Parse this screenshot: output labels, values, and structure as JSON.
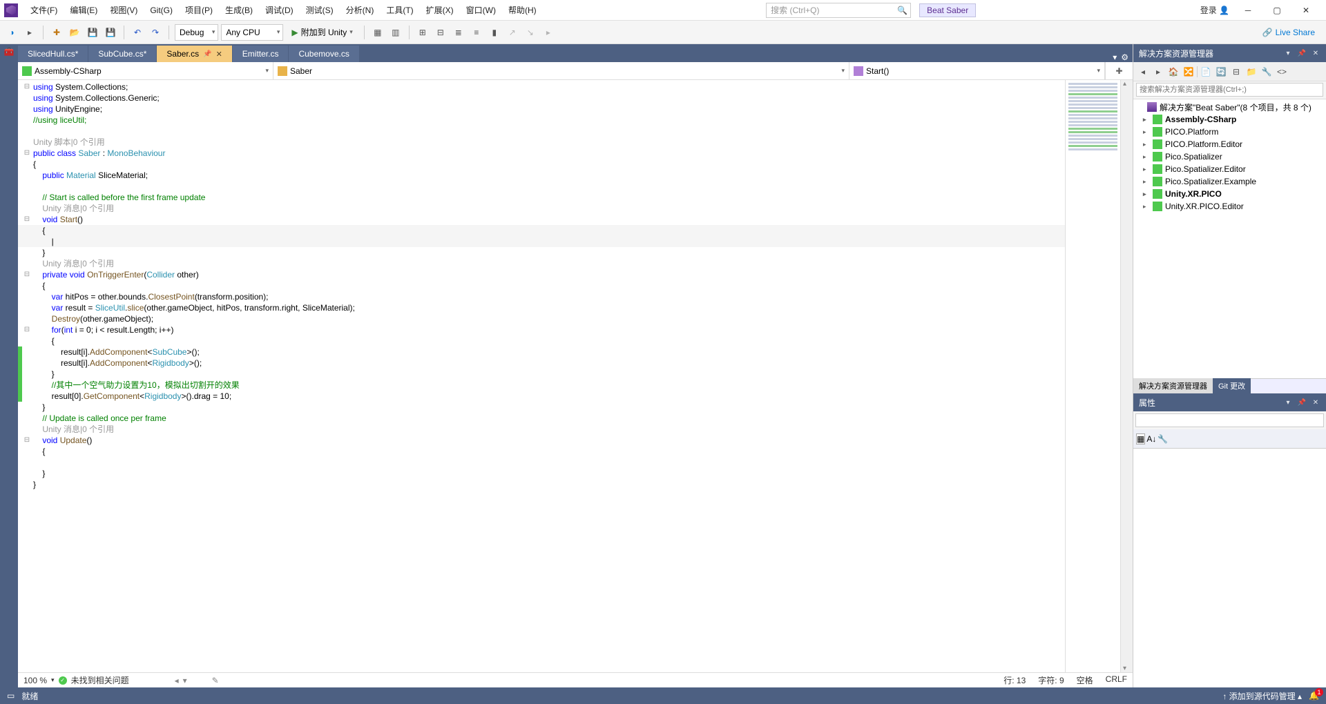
{
  "menu": {
    "items": [
      "文件(F)",
      "编辑(E)",
      "视图(V)",
      "Git(G)",
      "项目(P)",
      "生成(B)",
      "调试(D)",
      "测试(S)",
      "分析(N)",
      "工具(T)",
      "扩展(X)",
      "窗口(W)",
      "帮助(H)"
    ],
    "search_placeholder": "搜索 (Ctrl+Q)",
    "project": "Beat Saber",
    "login": "登录",
    "win": {
      "min": "─",
      "max": "▢",
      "close": "✕"
    }
  },
  "toolbar": {
    "config": "Debug",
    "platform": "Any CPU",
    "run_label": "附加到 Unity",
    "live_share": "Live Share"
  },
  "tabs": [
    {
      "label": "SlicedHull.cs*",
      "active": false
    },
    {
      "label": "SubCube.cs*",
      "active": false
    },
    {
      "label": "Saber.cs",
      "active": true,
      "pinned": true,
      "closable": true
    },
    {
      "label": "Emitter.cs",
      "active": false
    },
    {
      "label": "Cubemove.cs",
      "active": false
    }
  ],
  "nav": {
    "project": "Assembly-CSharp",
    "class": "Saber",
    "member": "Start()"
  },
  "code": {
    "lines": [
      {
        "fold": "⊟",
        "html": "<span class='kw'>using</span> System.Collections;"
      },
      {
        "fold": "",
        "html": "<span class='kw'>using</span> System.Collections.Generic;"
      },
      {
        "fold": "",
        "html": "<span class='kw'>using</span> UnityEngine;"
      },
      {
        "fold": "",
        "html": "<span class='cmt'>//using liceUtil;</span>"
      },
      {
        "fold": "",
        "html": ""
      },
      {
        "fold": "",
        "html": "<span class='gray'>Unity 脚本|0 个引用</span>"
      },
      {
        "fold": "⊟",
        "html": "<span class='kw'>public class</span> <span class='cls'>Saber</span> : <span class='cls'>MonoBehaviour</span>"
      },
      {
        "fold": "",
        "html": "{"
      },
      {
        "fold": "",
        "html": "    <span class='kw'>public</span> <span class='cls'>Material</span> SliceMaterial;"
      },
      {
        "fold": "",
        "html": ""
      },
      {
        "fold": "",
        "html": "    <span class='cmt'>// Start is called before the first frame update</span>"
      },
      {
        "fold": "",
        "html": "    <span class='gray'>Unity 消息|0 个引用</span>"
      },
      {
        "fold": "⊟",
        "html": "    <span class='kw'>void</span> <span class='mtd'>Start</span>()"
      },
      {
        "fold": "",
        "html": "    {",
        "caret": true
      },
      {
        "fold": "",
        "html": "        |",
        "caret": true
      },
      {
        "fold": "",
        "html": "    }"
      },
      {
        "fold": "",
        "html": "    <span class='gray'>Unity 消息|0 个引用</span>"
      },
      {
        "fold": "⊟",
        "html": "    <span class='kw'>private void</span> <span class='mtd'>OnTriggerEnter</span>(<span class='cls'>Collider</span> other)"
      },
      {
        "fold": "",
        "html": "    {"
      },
      {
        "fold": "",
        "html": "        <span class='kw'>var</span> hitPos = other.bounds.<span class='mtd'>ClosestPoint</span>(transform.position);"
      },
      {
        "fold": "",
        "html": "        <span class='kw'>var</span> result = <span class='cls'>SliceUtil</span>.<span class='mtd'>slice</span>(other.gameObject, hitPos, transform.right, SliceMaterial);"
      },
      {
        "fold": "",
        "html": "        <span class='mtd'>Destroy</span>(other.gameObject);"
      },
      {
        "fold": "⊟",
        "html": "        <span class='kw'>for</span>(<span class='kw'>int</span> i = 0; i &lt; result.Length; i++)"
      },
      {
        "fold": "",
        "html": "        {"
      },
      {
        "fold": "",
        "mark": "green",
        "html": "            result[i].<span class='mtd'>AddComponent</span>&lt;<span class='cls'>SubCube</span>&gt;();"
      },
      {
        "fold": "",
        "mark": "green",
        "html": "            result[i].<span class='mtd'>AddComponent</span>&lt;<span class='cls'>Rigidbody</span>&gt;();"
      },
      {
        "fold": "",
        "mark": "green",
        "html": "        }"
      },
      {
        "fold": "",
        "mark": "green",
        "html": "        <span class='cmt'>//其中一个空气助力设置为10，模拟出切割开的效果</span>"
      },
      {
        "fold": "",
        "mark": "green",
        "html": "        result[0].<span class='mtd'>GetComponent</span>&lt;<span class='cls'>Rigidbody</span>&gt;().drag = 10;"
      },
      {
        "fold": "",
        "html": "    }"
      },
      {
        "fold": "",
        "html": "    <span class='cmt'>// Update is called once per frame</span>"
      },
      {
        "fold": "",
        "html": "    <span class='gray'>Unity 消息|0 个引用</span>"
      },
      {
        "fold": "⊟",
        "html": "    <span class='kw'>void</span> <span class='mtd'>Update</span>()"
      },
      {
        "fold": "",
        "html": "    {"
      },
      {
        "fold": "",
        "html": "        "
      },
      {
        "fold": "",
        "html": "    }"
      },
      {
        "fold": "",
        "html": "}"
      }
    ]
  },
  "editor_status": {
    "zoom": "100 %",
    "issues": "未找到相关问题",
    "line": "行: 13",
    "col": "字符: 9",
    "ins": "空格",
    "eol": "CRLF"
  },
  "solution": {
    "title": "解决方案资源管理器",
    "search_placeholder": "搜索解决方案资源管理器(Ctrl+;)",
    "root": "解决方案\"Beat Saber\"(8 个项目，共 8 个)",
    "projects": [
      {
        "name": "Assembly-CSharp",
        "bold": true
      },
      {
        "name": "PICO.Platform",
        "bold": false
      },
      {
        "name": "PICO.Platform.Editor",
        "bold": false
      },
      {
        "name": "Pico.Spatializer",
        "bold": false
      },
      {
        "name": "Pico.Spatializer.Editor",
        "bold": false
      },
      {
        "name": "Pico.Spatializer.Example",
        "bold": false
      },
      {
        "name": "Unity.XR.PICO",
        "bold": true
      },
      {
        "name": "Unity.XR.PICO.Editor",
        "bold": false
      }
    ],
    "bottom_tabs": [
      "解决方案资源管理器",
      "Git 更改"
    ]
  },
  "properties": {
    "title": "属性"
  },
  "statusbar": {
    "ready": "就绪",
    "scm": "添加到源代码管理",
    "notif_count": "1"
  }
}
